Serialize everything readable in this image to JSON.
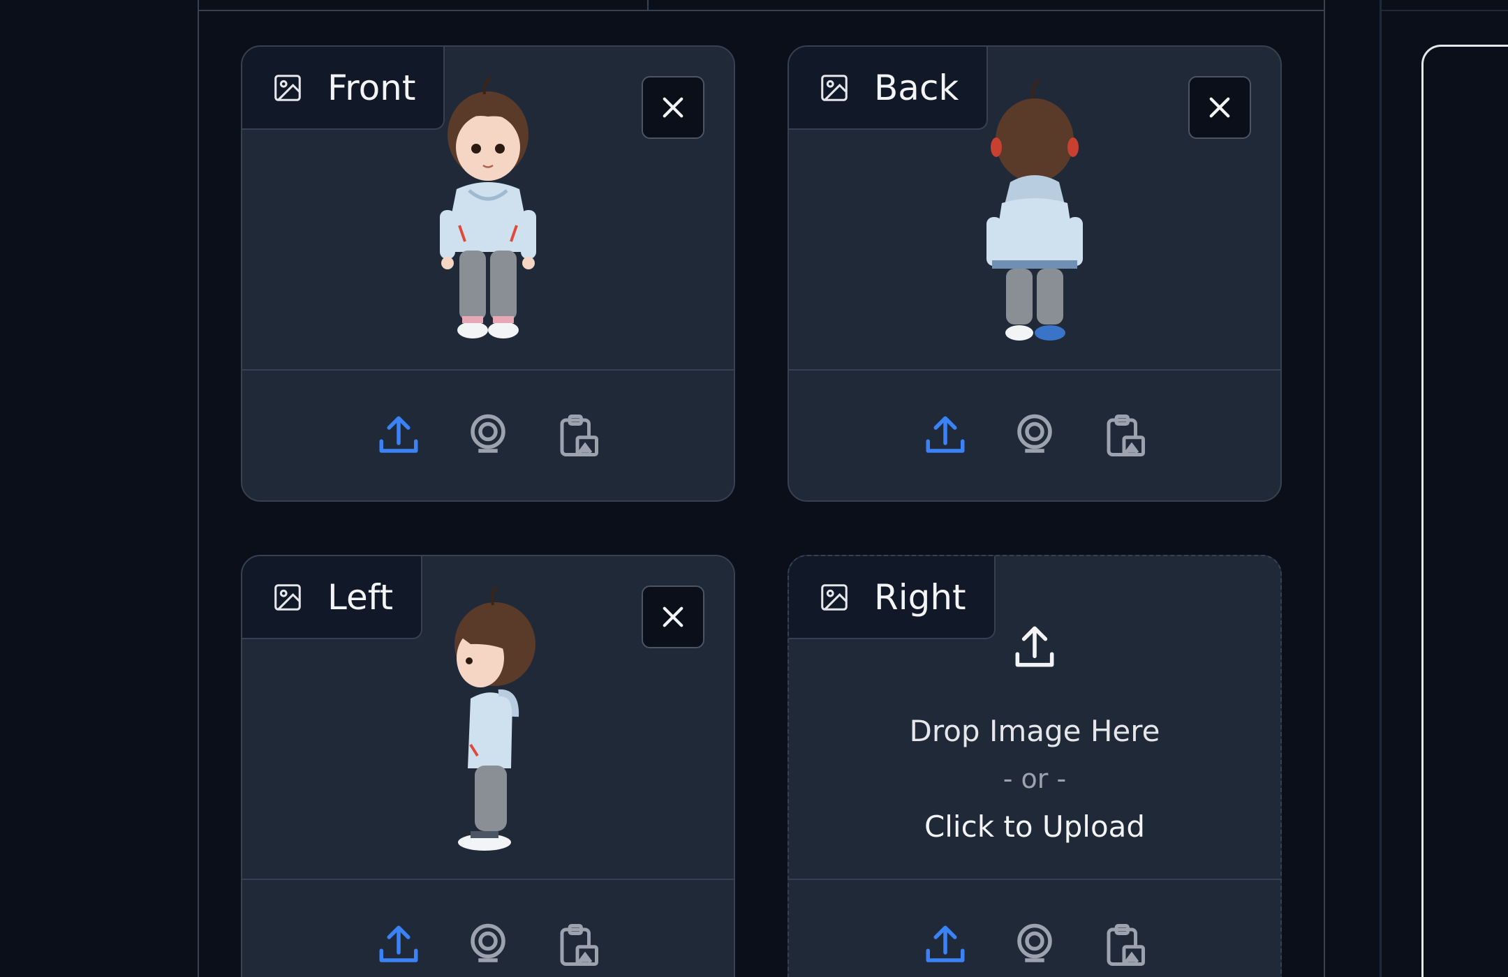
{
  "cards": {
    "front": {
      "label": "Front"
    },
    "back": {
      "label": "Back"
    },
    "left": {
      "label": "Left"
    },
    "right": {
      "label": "Right",
      "drop_title": "Drop Image Here",
      "drop_or": "- or -",
      "drop_click": "Click to Upload"
    }
  },
  "icons": {
    "card_header": "image-icon",
    "close": "close-icon",
    "upload": "upload-icon",
    "webcam": "webcam-icon",
    "clipboard": "clipboard-image-icon"
  },
  "colors": {
    "accent": "#3b82f6",
    "background": "#0b0f19",
    "card": "#1f2937",
    "border": "#374151"
  }
}
